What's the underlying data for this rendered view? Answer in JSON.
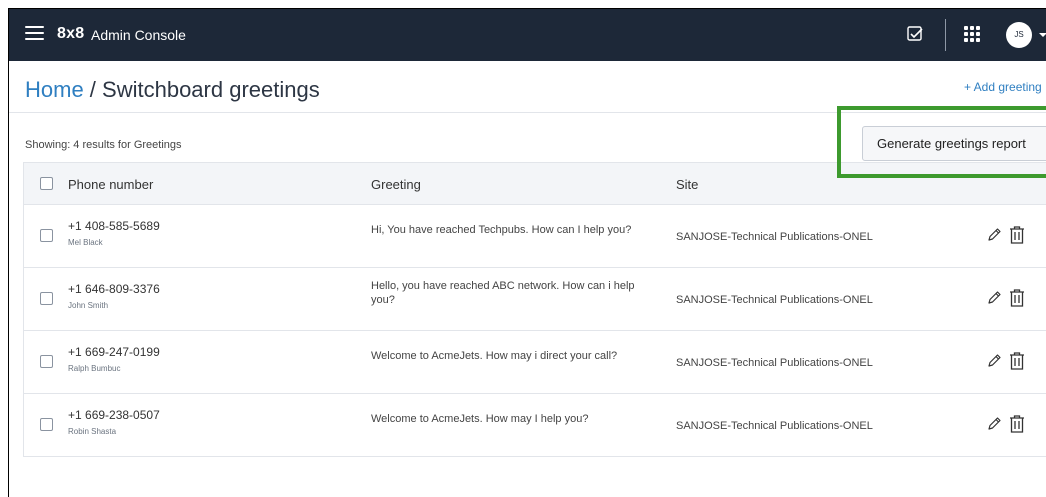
{
  "app": {
    "brand": "8x8",
    "product": "Admin Console",
    "avatar_initials": "JS"
  },
  "breadcrumb": {
    "home": "Home",
    "separator": " / ",
    "current": "Switchboard greetings"
  },
  "add_greeting": "+ Add greeting",
  "showing_text": "Showing: 4 results for Greetings",
  "report_button": "Generate greetings report",
  "table": {
    "columns": [
      "Phone number",
      "Greeting",
      "Site"
    ],
    "rows": [
      {
        "phone": "+1 408-585-5689",
        "name": "Mel Black",
        "greeting": "Hi, You have reached Techpubs. How can I help you?",
        "site": "SANJOSE-Technical Publications-ONEL"
      },
      {
        "phone": "+1 646-809-3376",
        "name": "John Smith",
        "greeting": "Hello, you have reached ABC network. How can i help you?",
        "site": "SANJOSE-Technical Publications-ONEL"
      },
      {
        "phone": "+1 669-247-0199",
        "name": "Ralph Bumbuc",
        "greeting": "Welcome to AcmeJets. How may i direct your call?",
        "site": "SANJOSE-Technical Publications-ONEL"
      },
      {
        "phone": "+1 669-238-0507",
        "name": "Robin Shasta",
        "greeting": "Welcome to AcmeJets. How may I help you?",
        "site": "SANJOSE-Technical Publications-ONEL"
      }
    ]
  },
  "icons": {
    "menu": "hamburger-menu-icon",
    "tasks": "checkbox-tasks-icon",
    "apps": "app-grid-icon",
    "edit": "pencil-icon",
    "delete": "trash-icon"
  },
  "colors": {
    "topbar": "#1d2838",
    "link": "#2f7fc1",
    "highlight": "#3d9a2e"
  }
}
